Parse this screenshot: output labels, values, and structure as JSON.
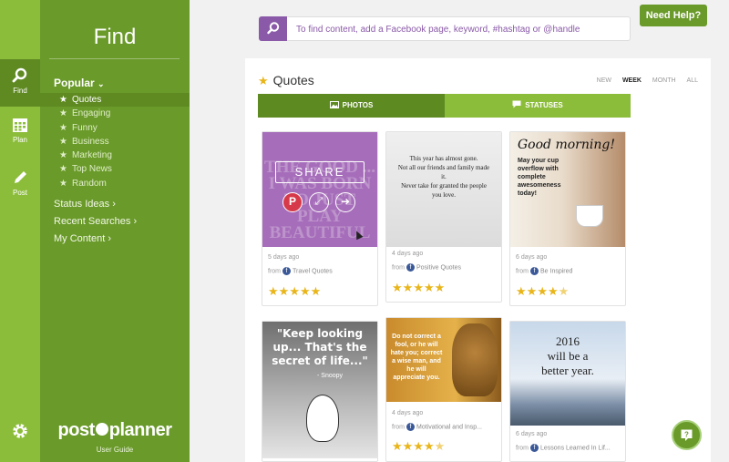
{
  "nav_rail": {
    "items": [
      {
        "label": "Find",
        "icon": "search-icon"
      },
      {
        "label": "Plan",
        "icon": "calendar-icon"
      },
      {
        "label": "Post",
        "icon": "pencil-icon"
      }
    ],
    "settings_icon": "gear-icon"
  },
  "sidebar": {
    "title": "Find",
    "popular_label": "Popular",
    "popular_items": [
      "Quotes",
      "Engaging",
      "Funny",
      "Business",
      "Marketing",
      "Top News",
      "Random"
    ],
    "links": [
      "Status Ideas",
      "Recent Searches",
      "My Content"
    ],
    "logo_left": "post",
    "logo_right": "planner",
    "user_guide": "User Guide"
  },
  "search": {
    "placeholder": "To find content, add a Facebook page, keyword, #hashtag or @handle"
  },
  "help_button": "Need Help?",
  "section": {
    "title": "Quotes",
    "time_filters": [
      "NEW",
      "WEEK",
      "MONTH",
      "ALL"
    ],
    "active_filter": "WEEK"
  },
  "tabs": {
    "photos": "PHOTOS",
    "statuses": "STATUSES"
  },
  "cards": [
    {
      "date": "5 days ago",
      "from": "from",
      "source": "Travel Quotes",
      "rating": 5,
      "image_text": "THE GOOD ... I WAS BORN TO JUST PLAY BEAUTIFUL",
      "overlay": {
        "share_label": "SHARE"
      }
    },
    {
      "date": "4 days ago",
      "from": "from",
      "source": "Positive Quotes",
      "rating": 5,
      "image_text": "This year has almost gone.\nNot all our friends and family made it.\nNever take for granted the people you love."
    },
    {
      "date": "6 days ago",
      "from": "from",
      "source": "Be Inspired",
      "rating": 4.5,
      "image_title": "Good morning!",
      "image_text": "May your cup overflow with complete awesomeness today!"
    },
    {
      "date": "",
      "from": "",
      "source": "",
      "rating": 0,
      "image_title": "\"Keep looking up... That's the secret of life...\"",
      "image_text": "- Snoopy"
    },
    {
      "date": "4 days ago",
      "from": "from",
      "source": "Motivational and Insp...",
      "rating": 4.5,
      "image_text": "Do not correct a fool, or he will hate you; correct a wise man, and he will appreciate you."
    },
    {
      "date": "6 days ago",
      "from": "from",
      "source": "Lessons Learned In Lif...",
      "rating": 0,
      "image_text": "2016\nwill be a\nbetter year."
    }
  ],
  "colors": {
    "rail_green": "#8cbd3a",
    "sidebar_green": "#6a9a2a",
    "active_green": "#5f8a22",
    "search_purple": "#8a5aa8",
    "star_gold": "#e8b51a",
    "facebook_blue": "#3b5998"
  }
}
